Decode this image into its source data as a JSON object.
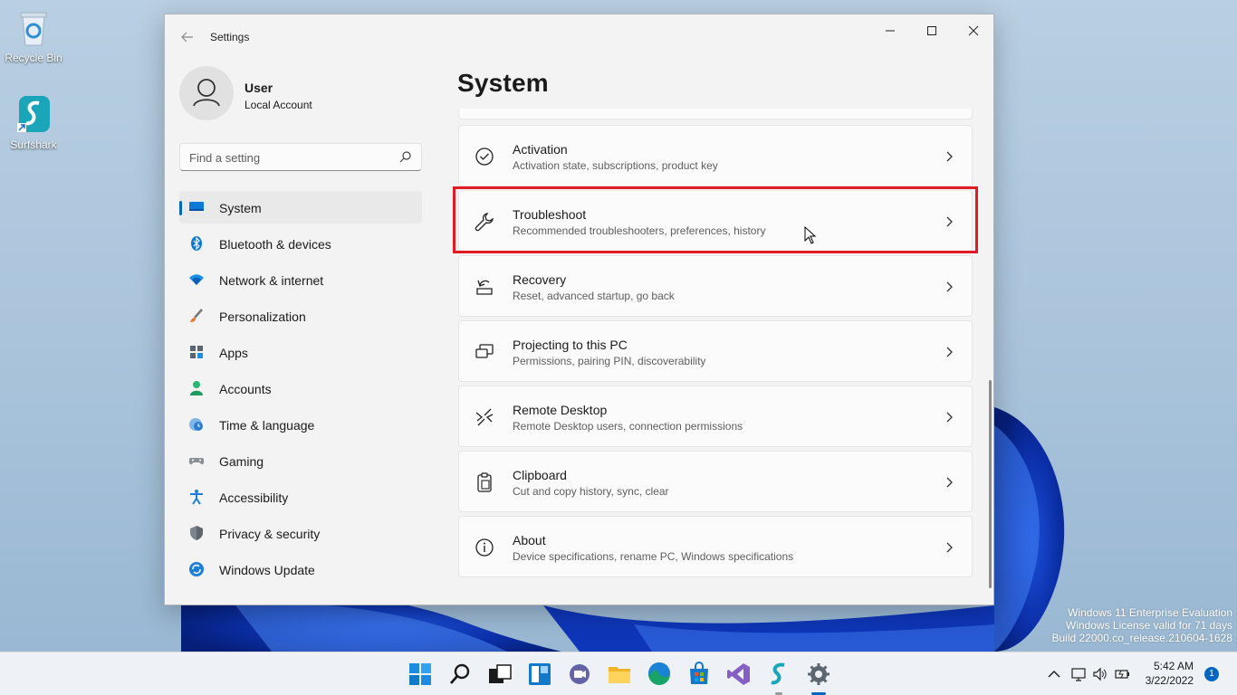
{
  "desktop": {
    "icons": [
      {
        "label": "Recycle Bin",
        "icon": "recycle-bin-icon"
      },
      {
        "label": "Surfshark",
        "icon": "surfshark-icon"
      }
    ],
    "watermark": {
      "line1": "Windows 11 Enterprise Evaluation",
      "line2": "Windows License valid for 71 days",
      "line3": "Build 22000.co_release.210604-1628"
    }
  },
  "window": {
    "title": "Settings",
    "profile": {
      "name": "User",
      "account_type": "Local Account"
    },
    "search": {
      "placeholder": "Find a setting"
    },
    "nav": [
      {
        "label": "System",
        "icon": "system-icon",
        "active": true
      },
      {
        "label": "Bluetooth & devices",
        "icon": "bluetooth-icon"
      },
      {
        "label": "Network & internet",
        "icon": "wifi-icon"
      },
      {
        "label": "Personalization",
        "icon": "brush-icon"
      },
      {
        "label": "Apps",
        "icon": "apps-icon"
      },
      {
        "label": "Accounts",
        "icon": "person-icon"
      },
      {
        "label": "Time & language",
        "icon": "clock-globe-icon"
      },
      {
        "label": "Gaming",
        "icon": "controller-icon"
      },
      {
        "label": "Accessibility",
        "icon": "accessibility-icon"
      },
      {
        "label": "Privacy & security",
        "icon": "shield-icon"
      },
      {
        "label": "Windows Update",
        "icon": "update-icon"
      }
    ],
    "page_title": "System",
    "cards": [
      {
        "title": "Activation",
        "subtitle": "Activation state, subscriptions, product key",
        "icon": "check-circle-icon"
      },
      {
        "title": "Troubleshoot",
        "subtitle": "Recommended troubleshooters, preferences, history",
        "icon": "wrench-icon"
      },
      {
        "title": "Recovery",
        "subtitle": "Reset, advanced startup, go back",
        "icon": "recovery-icon"
      },
      {
        "title": "Projecting to this PC",
        "subtitle": "Permissions, pairing PIN, discoverability",
        "icon": "projecting-icon"
      },
      {
        "title": "Remote Desktop",
        "subtitle": "Remote Desktop users, connection permissions",
        "icon": "remote-desktop-icon"
      },
      {
        "title": "Clipboard",
        "subtitle": "Cut and copy history, sync, clear",
        "icon": "clipboard-icon"
      },
      {
        "title": "About",
        "subtitle": "Device specifications, rename PC, Windows specifications",
        "icon": "info-icon"
      }
    ]
  },
  "taskbar": {
    "apps": [
      "start-icon",
      "search-icon",
      "task-view-icon",
      "widgets-icon",
      "teams-chat-icon",
      "file-explorer-icon",
      "edge-icon",
      "store-icon",
      "visual-studio-icon",
      "surfshark-icon",
      "settings-icon"
    ],
    "time": "5:42 AM",
    "date": "3/22/2022",
    "notification_count": "1"
  },
  "colors": {
    "accent": "#0067c0",
    "highlight": "#e01b24"
  }
}
